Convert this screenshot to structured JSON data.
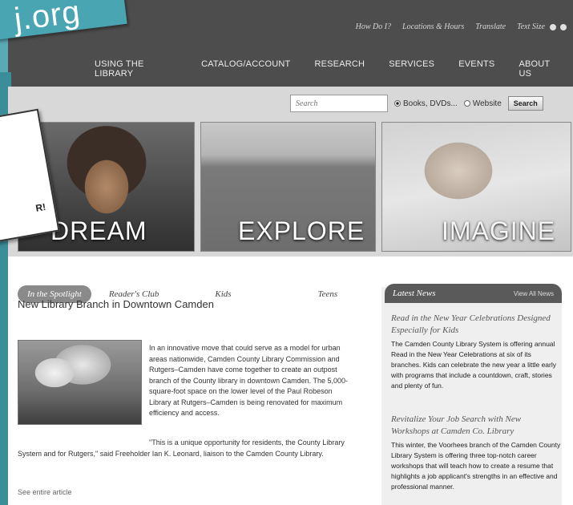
{
  "utility": {
    "how_do_i": "How Do I?",
    "locations": "Locations & Hours",
    "translate": "Translate",
    "text_size": "Text Size"
  },
  "nav": {
    "items": [
      "USING THE LIBRARY",
      "CATALOG/ACCOUNT",
      "RESEARCH",
      "SERVICES",
      "EVENTS",
      "ABOUT US"
    ]
  },
  "search": {
    "placeholder": "Search",
    "option_books": "Books, DVDs...",
    "option_website": "Website",
    "button": "Search"
  },
  "heroes": {
    "dream": "DREAM",
    "explore": "EXPLORE",
    "imagine": "IMAGINE"
  },
  "tabs": {
    "spotlight": "In the Spotlight",
    "readers": "Reader's Club",
    "kids": "Kids",
    "teens": "Teens"
  },
  "article": {
    "title": "New Library Branch in Downtown Camden",
    "p1": "In an innovative move that could serve as a model for urban areas nationwide, Camden County Library Commission and Rutgers–Camden have come together to create an outpost branch of the County library in downtown Camden. The 5,000-square-foot space on the lower level of the Paul Robeson Library at Rutgers–Camden is being renovated for maximum efficiency and access.",
    "p2": "\"This is a unique opportunity for residents, the County Library System and for Rutgers,\" said Freeholder Ian K. Leonard, liaison to the Camden County Library.",
    "see_more": "See entire article"
  },
  "news": {
    "header": "Latest News",
    "view_all": "View All News",
    "items": [
      {
        "title": "Read in the New Year Celebrations Designed Especially for Kids",
        "body": "The Camden County Library System is offering annual Read in the New Year Celebrations at six of its branches. Kids can celebrate the new year a little early with programs that include a countdown, craft, stories and plenty of fun."
      },
      {
        "title": "Revitalize Your Job Search with New Workshops at Camden Co. Library",
        "body": "This winter, the Voorhees branch of the Camden County Library System is offering three top-notch career workshops that will teach how to create a resume that highlights a job applicant's strengths in an effective and professional manner."
      }
    ]
  },
  "overlay": {
    "sticker_text": "j.org",
    "note_text": "R!"
  }
}
